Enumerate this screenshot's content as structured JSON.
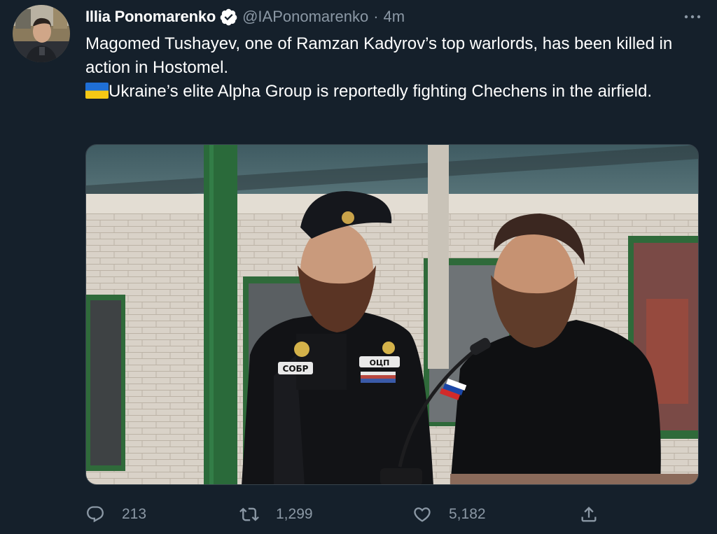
{
  "author": {
    "display_name": "Illia Ponomarenko",
    "handle": "@IAPonomarenko",
    "separator": "·",
    "timestamp": "4m",
    "verified": true,
    "avatar_icon": "user-avatar-photo"
  },
  "more_menu_icon": "ellipsis-icon",
  "tweet": {
    "line1": "Magomed Tushayev, one of Ramzan Kadyrov’s top warlords, has been killed in action in Hostomel.",
    "line2": "Ukraine’s elite Alpha Group is reportedly fighting Chechens in the airfield.",
    "flag_icon": "ukraine-flag-emoji"
  },
  "media": {
    "type": "photo",
    "patch_left": "СОБР",
    "patch_right": "ОЦП"
  },
  "actions": {
    "reply": {
      "icon": "reply-icon",
      "count": "213"
    },
    "retweet": {
      "icon": "retweet-icon",
      "count": "1,299"
    },
    "like": {
      "icon": "heart-icon",
      "count": "5,182"
    },
    "share": {
      "icon": "share-icon"
    }
  },
  "colors": {
    "background": "#15202b",
    "text_primary": "#ffffff",
    "text_secondary": "#8b98a5",
    "verified_badge": "#ffffff",
    "border": "#38444d"
  }
}
